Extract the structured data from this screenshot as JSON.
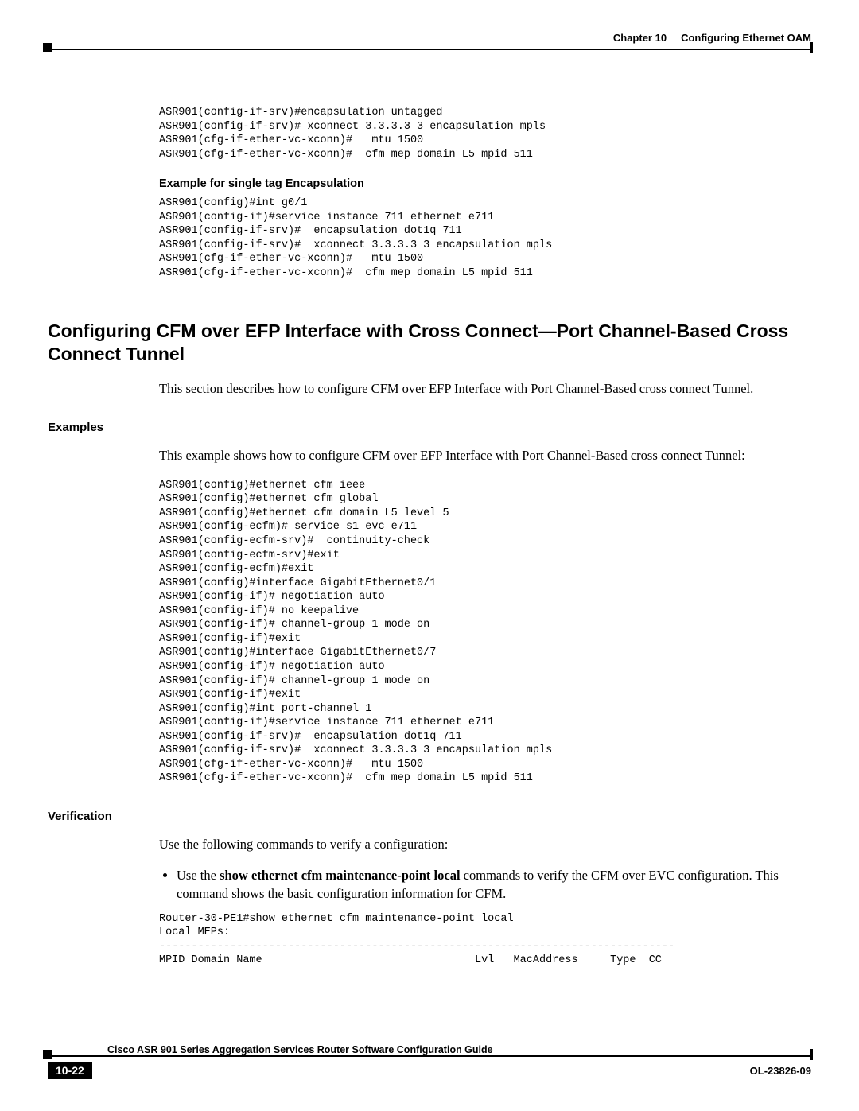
{
  "header": {
    "chapter": "Chapter 10",
    "title": "Configuring Ethernet OAM"
  },
  "code_block_1": "ASR901(config-if-srv)#encapsulation untagged\nASR901(config-if-srv)# xconnect 3.3.3.3 3 encapsulation mpls\nASR901(cfg-if-ether-vc-xconn)#   mtu 1500\nASR901(cfg-if-ether-vc-xconn)#  cfm mep domain L5 mpid 511",
  "subhead_1": "Example for single tag Encapsulation",
  "code_block_2": "ASR901(config)#int g0/1\nASR901(config-if)#service instance 711 ethernet e711\nASR901(config-if-srv)#  encapsulation dot1q 711\nASR901(config-if-srv)#  xconnect 3.3.3.3 3 encapsulation mpls\nASR901(cfg-if-ether-vc-xconn)#   mtu 1500\nASR901(cfg-if-ether-vc-xconn)#  cfm mep domain L5 mpid 511",
  "section_heading": "Configuring CFM over EFP Interface with Cross Connect—Port Channel-Based Cross Connect Tunnel",
  "section_para": "This section describes how to configure CFM over EFP Interface with Port Channel-Based cross connect Tunnel.",
  "examples_label": "Examples",
  "examples_para": "This example shows how to configure CFM over EFP Interface with Port Channel-Based cross connect Tunnel:",
  "code_block_3": "ASR901(config)#ethernet cfm ieee\nASR901(config)#ethernet cfm global\nASR901(config)#ethernet cfm domain L5 level 5\nASR901(config-ecfm)# service s1 evc e711\nASR901(config-ecfm-srv)#  continuity-check\nASR901(config-ecfm-srv)#exit\nASR901(config-ecfm)#exit\nASR901(config)#interface GigabitEthernet0/1\nASR901(config-if)# negotiation auto\nASR901(config-if)# no keepalive\nASR901(config-if)# channel-group 1 mode on\nASR901(config-if)#exit\nASR901(config)#interface GigabitEthernet0/7\nASR901(config-if)# negotiation auto\nASR901(config-if)# channel-group 1 mode on\nASR901(config-if)#exit\nASR901(config)#int port-channel 1\nASR901(config-if)#service instance 711 ethernet e711\nASR901(config-if-srv)#  encapsulation dot1q 711\nASR901(config-if-srv)#  xconnect 3.3.3.3 3 encapsulation mpls\nASR901(cfg-if-ether-vc-xconn)#   mtu 1500\nASR901(cfg-if-ether-vc-xconn)#  cfm mep domain L5 mpid 511",
  "verification_label": "Verification",
  "verification_para": "Use the following commands to verify a configuration:",
  "bullet_pre": "Use the ",
  "bullet_cmd": "show ethernet cfm maintenance-point local",
  "bullet_post": " commands to verify the CFM over EVC configuration. This command shows the basic configuration information for CFM.",
  "code_block_4": "Router-30-PE1#show ethernet cfm maintenance-point local\nLocal MEPs:\n--------------------------------------------------------------------------------\nMPID Domain Name                                 Lvl   MacAddress     Type  CC",
  "footer": {
    "guide": "Cisco ASR 901 Series Aggregation Services Router Software Configuration Guide",
    "page": "10-22",
    "docid": "OL-23826-09"
  }
}
